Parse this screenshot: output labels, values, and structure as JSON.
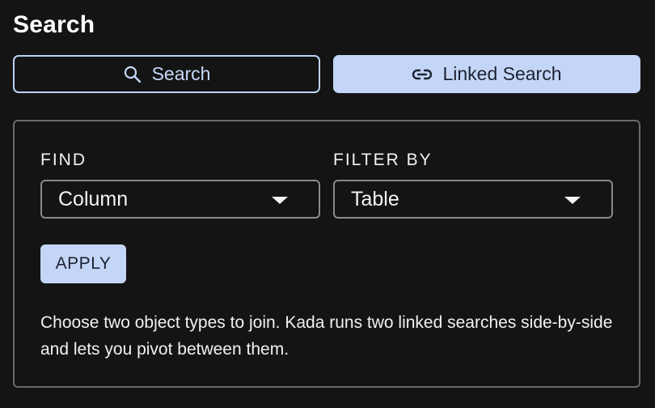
{
  "panel_title": "Search",
  "modes": {
    "search": {
      "label": "Search",
      "icon": "search-icon"
    },
    "linked_search": {
      "label": "Linked Search",
      "icon": "link-icon",
      "selected": true
    }
  },
  "find": {
    "label": "FIND",
    "value": "Column"
  },
  "filter_by": {
    "label": "FILTER BY",
    "value": "Table"
  },
  "apply_label": "APPLY",
  "help_text": "Choose two object types to join. Kada runs two linked searches side-by-side and lets you pivot between them.",
  "colors": {
    "background": "#141414",
    "accent": "#c4d6f8",
    "border": "#6a6a6a"
  }
}
